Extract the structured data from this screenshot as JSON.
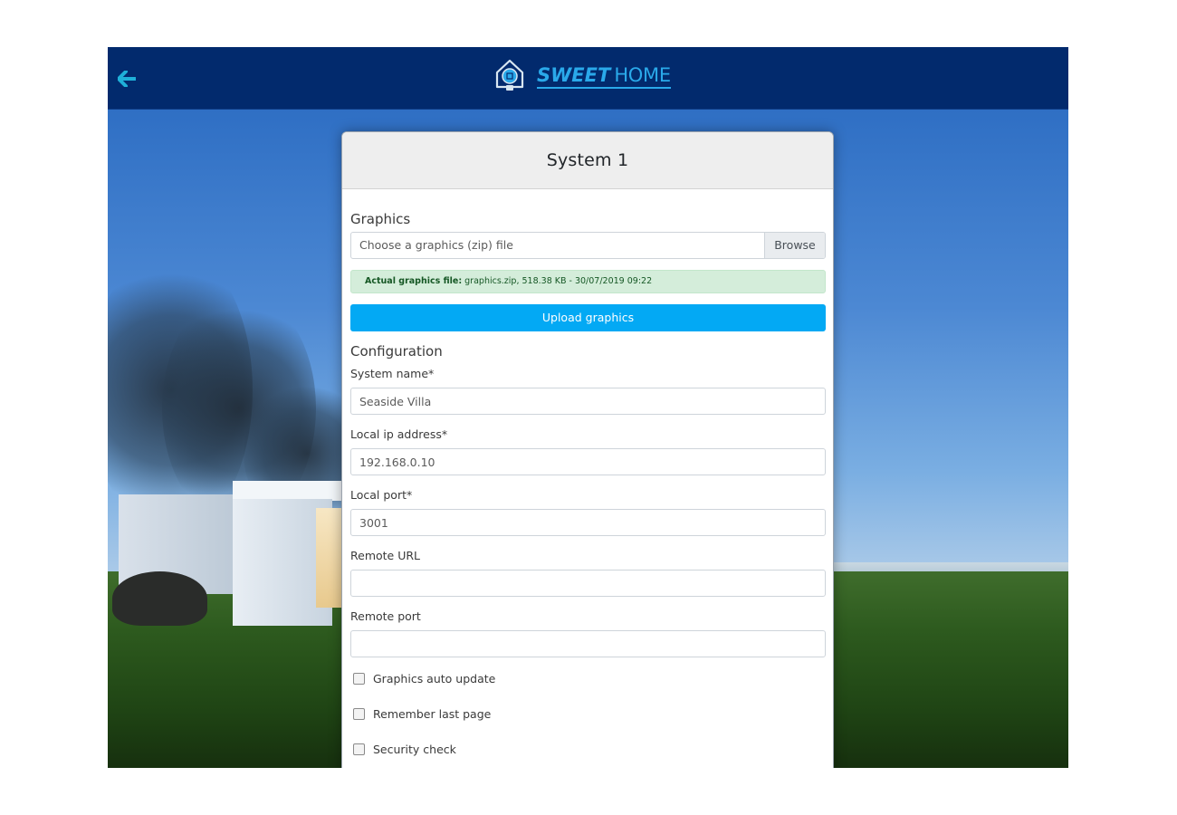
{
  "header": {
    "logo_bold": "SWEET",
    "logo_light": "HOME",
    "icons": {
      "back": "arrow-left-icon",
      "logo": "house-bulb-icon"
    },
    "colors": {
      "bar": "#022a6d",
      "accent": "#2aa9ea"
    }
  },
  "card": {
    "title": "System 1",
    "graphics": {
      "section_title": "Graphics",
      "file_placeholder": "Choose a graphics (zip) file",
      "browse_label": "Browse",
      "actual_label": "Actual graphics file:",
      "actual_value": "graphics.zip, 518.38 KB - 30/07/2019 09:22",
      "upload_label": "Upload graphics"
    },
    "configuration": {
      "section_title": "Configuration",
      "fields": [
        {
          "label": "System name*",
          "value": "Seaside Villa"
        },
        {
          "label": "Local ip address*",
          "value": "192.168.0.10"
        },
        {
          "label": "Local port*",
          "value": "3001"
        },
        {
          "label": "Remote URL",
          "value": ""
        },
        {
          "label": "Remote port",
          "value": ""
        }
      ],
      "checkboxes": [
        {
          "label": "Graphics auto update",
          "checked": false
        },
        {
          "label": "Remember last page",
          "checked": false
        },
        {
          "label": "Security check",
          "checked": false
        }
      ]
    },
    "colors": {
      "upload_button": "#03a9f4",
      "alert_bg": "#d4edda",
      "alert_text": "#155724"
    }
  }
}
